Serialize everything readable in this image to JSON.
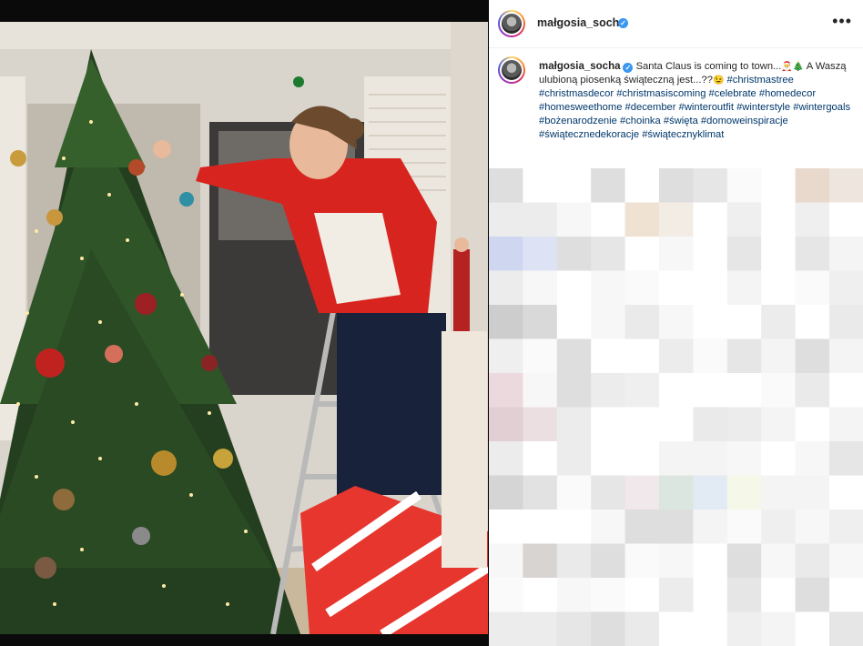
{
  "post": {
    "username": "małgosia_socha",
    "verified_mark": "✓",
    "more_icon": "•••",
    "caption": {
      "username": "małgosia_socha",
      "text_before": "Santa Claus is coming to town...",
      "emoji_1": "🎅",
      "emoji_2": "🎄",
      "text_after": " A Waszą ulubioną piosenką świąteczną jest...??",
      "emoji_3": "😉",
      "hashtags": [
        "#christmastree",
        "#christmasdecor",
        "#christmasiscoming",
        "#celebrate",
        "#homedecor",
        "#homesweethome",
        "#december",
        "#winteroutfit",
        "#winterstyle",
        "#wintergoals",
        "#bożenarodzenie",
        "#choinka",
        "#święta",
        "#domoweinspiracje",
        "#świątecznedekoracje",
        "#świątecznyklimat"
      ]
    }
  },
  "colors": {
    "hashtag": "#00376b",
    "text": "#262626",
    "verified": "#3897f0"
  }
}
